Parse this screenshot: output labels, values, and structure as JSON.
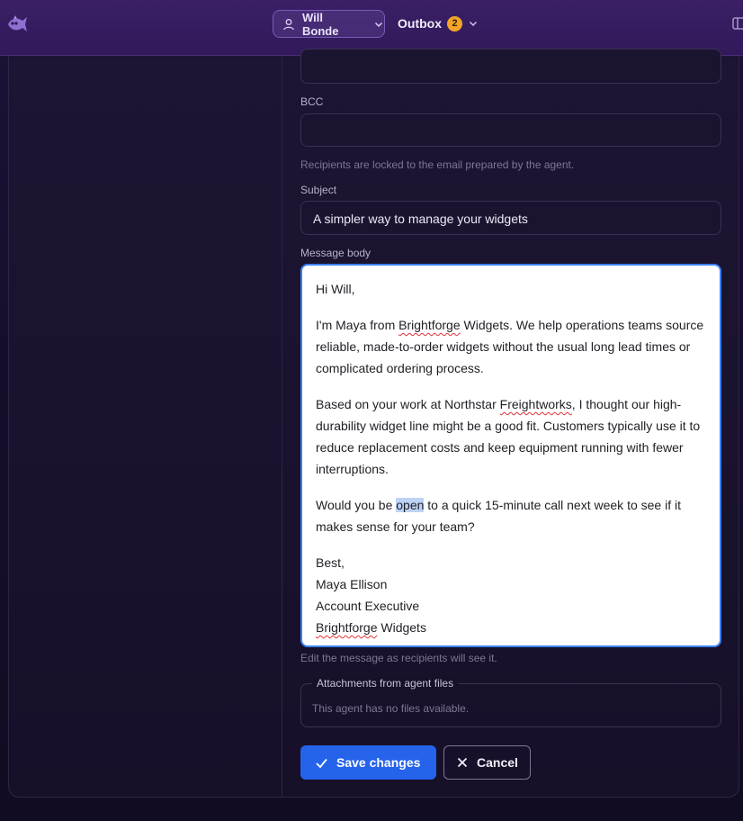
{
  "topbar": {
    "user_name": "Will Bonde",
    "outbox_label": "Outbox",
    "outbox_count": "2"
  },
  "form": {
    "bcc_label": "BCC",
    "bcc_value": "",
    "recipients_hint": "Recipients are locked to the email prepared by the agent.",
    "subject_label": "Subject",
    "subject_value": "A simpler way to manage your widgets",
    "body_label": "Message body",
    "body": {
      "greeting": "Hi Will,",
      "p1_before": "I'm Maya from ",
      "p1_brand": "Brightforge",
      "p1_after": " Widgets. We help operations teams source reliable, made-to-order widgets without the usual long lead times or complicated ordering process.",
      "p2_before": "Based on your work at Northstar ",
      "p2_company": "Freightworks",
      "p2_after": ", I thought our high-durability widget line might be a good fit. Customers typically use it to reduce replacement costs and keep equipment running with fewer interruptions.",
      "p3_before": "Would you be ",
      "p3_selected": "open",
      "p3_after": " to a quick 15-minute call next week to see if it makes sense for your team?",
      "signoff": "Best,",
      "sig_name": "Maya Ellison",
      "sig_title": "Account Executive",
      "sig_brand": "Brightforge",
      "sig_company_rest": " Widgets"
    },
    "body_hint": "Edit the message as recipients will see it.",
    "attachments_label": "Attachments from agent files",
    "attachments_empty": "This agent has no files available.",
    "save_label": "Save changes",
    "cancel_label": "Cancel"
  },
  "colors": {
    "accent": "#2563eb",
    "badge": "#f2a52a",
    "focus": "#3b82f6"
  }
}
